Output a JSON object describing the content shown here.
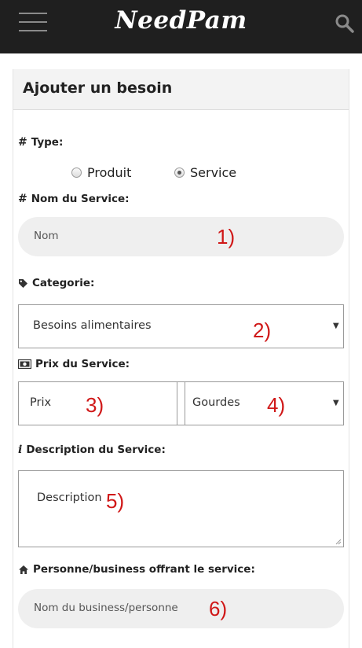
{
  "header": {
    "brand": "NeedPam"
  },
  "card": {
    "title": "Ajouter un besoin"
  },
  "type_field": {
    "label": "Type:",
    "options": [
      {
        "label": "Produit",
        "checked": false
      },
      {
        "label": "Service",
        "checked": true
      }
    ]
  },
  "name_field": {
    "label": "Nom du Service:",
    "placeholder": "Nom"
  },
  "category_field": {
    "label": "Categorie:",
    "value": "Besoins alimentaires"
  },
  "price_field": {
    "label": "Prix du Service:",
    "placeholder": "Prix",
    "currency": "Gourdes"
  },
  "description_field": {
    "label": "Description du Service:",
    "placeholder": "Description"
  },
  "provider_field": {
    "label": "Personne/business offrant le service:",
    "placeholder": "Nom du business/personne"
  },
  "annotations": [
    "1)",
    "2)",
    "3)",
    "4)",
    "5)",
    "6)"
  ],
  "colors": {
    "topbar": "#1f1f1f",
    "annotation": "#d01818",
    "input_fill": "#efefef",
    "border": "#9a9a9a"
  }
}
